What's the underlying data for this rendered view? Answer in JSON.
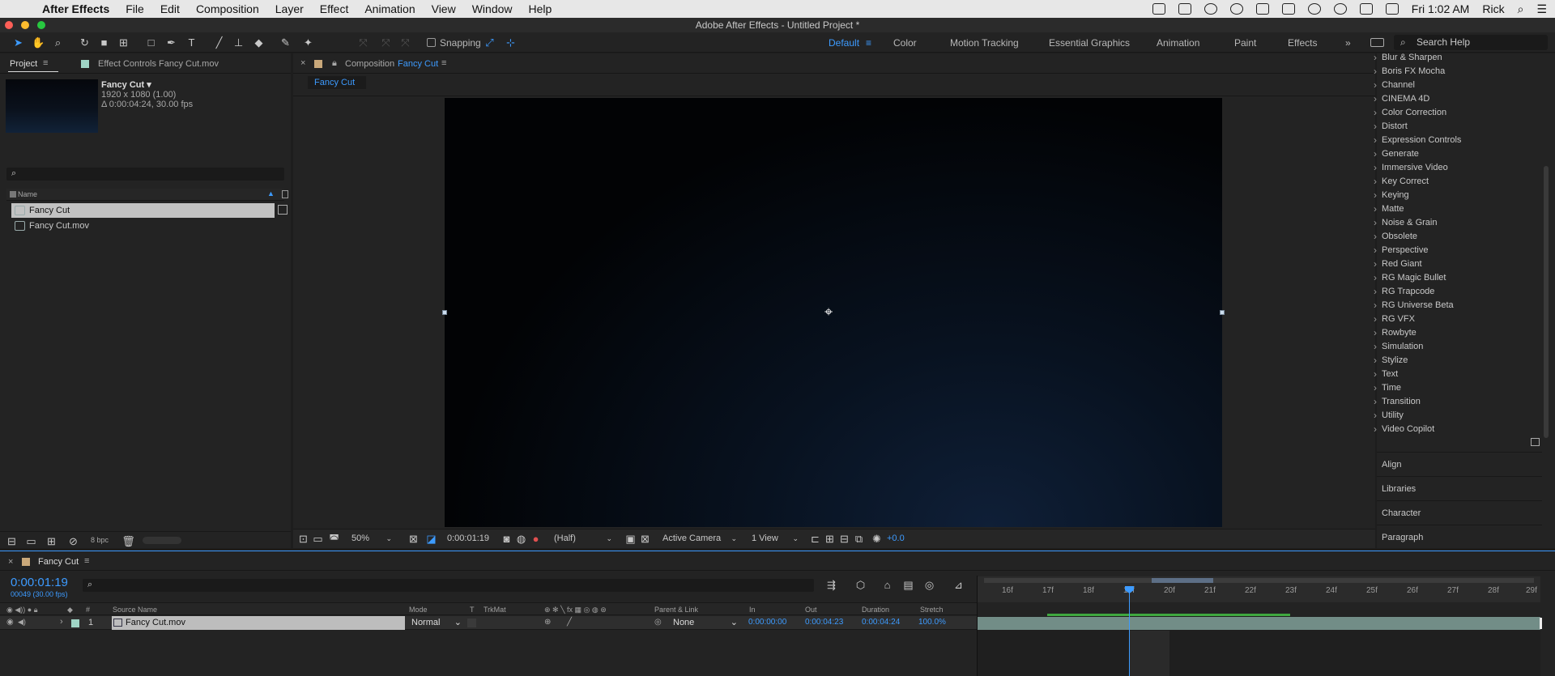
{
  "menubar": {
    "app": "After Effects",
    "items": [
      "File",
      "Edit",
      "Composition",
      "Layer",
      "Effect",
      "Animation",
      "View",
      "Window",
      "Help"
    ],
    "clock": "Fri 1:02 AM",
    "user": "Rick"
  },
  "window": {
    "title": "Adobe After Effects - Untitled Project *"
  },
  "toolbar": {
    "snapping_label": "Snapping",
    "workspaces": [
      "Default",
      "Color",
      "Motion Tracking",
      "Essential Graphics",
      "Animation",
      "Paint",
      "Effects"
    ],
    "active_workspace": "Default",
    "search_placeholder": "Search Help"
  },
  "project_panel": {
    "tab_project": "Project",
    "tab_effect_controls": "Effect Controls Fancy Cut.mov",
    "item_name": "Fancy Cut ▾",
    "item_dims": "1920 x 1080 (1.00)",
    "item_duration": "Δ 0:00:04:24, 30.00 fps",
    "name_col": "Name",
    "items": [
      "Fancy Cut",
      "Fancy Cut.mov"
    ],
    "bpc": "8 bpc"
  },
  "comp_panel": {
    "tab_prefix": "Composition",
    "tab_comp": "Fancy Cut",
    "sub_tab": "Fancy Cut",
    "zoom": "50%",
    "timecode": "0:00:01:19",
    "resolution": "(Half)",
    "camera": "Active Camera",
    "view": "1 View",
    "exposure": "+0.0"
  },
  "effects_panel": {
    "items": [
      "Blur & Sharpen",
      "Boris FX Mocha",
      "Channel",
      "CINEMA 4D",
      "Color Correction",
      "Distort",
      "Expression Controls",
      "Generate",
      "Immersive Video",
      "Key Correct",
      "Keying",
      "Matte",
      "Noise & Grain",
      "Obsolete",
      "Perspective",
      "Red Giant",
      "RG Magic Bullet",
      "RG Trapcode",
      "RG Universe Beta",
      "RG VFX",
      "Rowbyte",
      "Simulation",
      "Stylize",
      "Text",
      "Time",
      "Transition",
      "Utility",
      "Video Copilot"
    ],
    "subpanels": [
      "Align",
      "Libraries",
      "Character",
      "Paragraph"
    ]
  },
  "timeline": {
    "tab": "Fancy Cut",
    "timecode": "0:00:01:19",
    "frame_info": "00049 (30.00 fps)",
    "columns": {
      "hash": "#",
      "source": "Source Name",
      "mode": "Mode",
      "t": "T",
      "trkmat": "TrkMat",
      "parent": "Parent & Link",
      "in": "In",
      "out": "Out",
      "duration": "Duration",
      "stretch": "Stretch"
    },
    "layer": {
      "num": "1",
      "name": "Fancy Cut.mov",
      "mode": "Normal",
      "parent": "None",
      "in": "0:00:00:00",
      "out": "0:00:04:23",
      "duration": "0:00:04:24",
      "stretch": "100.0%"
    },
    "ruler": [
      "16f",
      "17f",
      "18f",
      "19f",
      "20f",
      "21f",
      "22f",
      "23f",
      "24f",
      "25f",
      "26f",
      "27f",
      "28f",
      "29f"
    ]
  }
}
